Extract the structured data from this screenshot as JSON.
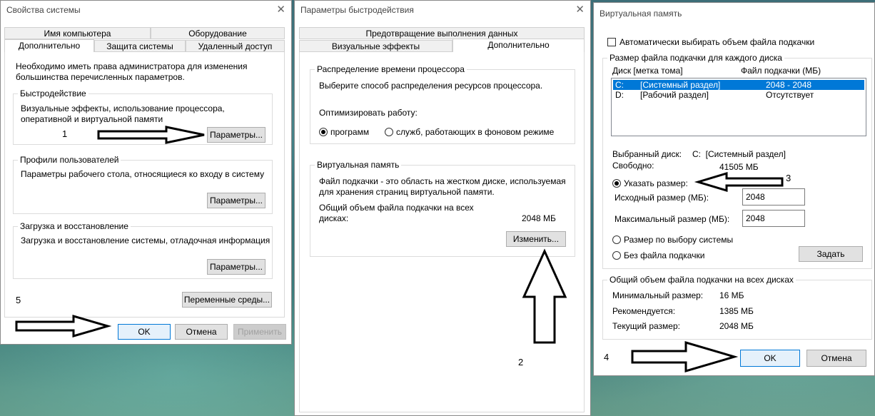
{
  "sys_props": {
    "title": "Свойства системы",
    "tabs_top": [
      "Имя компьютера",
      "Оборудование"
    ],
    "tabs_bottom": [
      "Дополнительно",
      "Защита системы",
      "Удаленный доступ"
    ],
    "admin_note": "Необходимо иметь права администратора для изменения большинства перечисленных параметров.",
    "perf": {
      "title": "Быстродействие",
      "desc": "Визуальные эффекты, использование процессора, оперативной и виртуальной памяти",
      "button": "Параметры..."
    },
    "profiles": {
      "title": "Профили пользователей",
      "desc": "Параметры рабочего стола, относящиеся ко входу в систему",
      "button": "Параметры..."
    },
    "startup": {
      "title": "Загрузка и восстановление",
      "desc": "Загрузка и восстановление системы, отладочная информация",
      "button": "Параметры..."
    },
    "env_button": "Переменные среды...",
    "ok": "OK",
    "cancel": "Отмена",
    "apply": "Применить"
  },
  "perf_opts": {
    "title": "Параметры быстродействия",
    "tab_top": "Предотвращение выполнения данных",
    "tabs_bottom": [
      "Визуальные эффекты",
      "Дополнительно"
    ],
    "cpu": {
      "title": "Распределение времени процессора",
      "desc": "Выберите способ распределения ресурсов процессора.",
      "optimize_label": "Оптимизировать работу:",
      "opt1": "программ",
      "opt2": "служб, работающих в фоновом режиме"
    },
    "vm": {
      "title": "Виртуальная память",
      "desc": "Файл подкачки - это область на жестком диске, используемая для хранения страниц виртуальной памяти.",
      "total_label": "Общий объем файла подкачки на всех дисках:",
      "total_value": "2048 МБ",
      "button": "Изменить..."
    }
  },
  "vmem": {
    "title": "Виртуальная память",
    "auto_label": "Автоматически выбирать объем файла подкачки",
    "group_title": "Размер файла подкачки для каждого диска",
    "col_disk": "Диск [метка тома]",
    "col_file": "Файл подкачки (МБ)",
    "rows": [
      {
        "drive": "C:",
        "label": "[Системный раздел]",
        "size": "2048 - 2048"
      },
      {
        "drive": "D:",
        "label": "[Рабочий раздел]",
        "size": "Отсутствует"
      }
    ],
    "selected_label": "Выбранный диск:",
    "selected_value": "C:  [Системный раздел]",
    "free_label": "Свободно:",
    "free_value": "41505 МБ",
    "custom_label": "Указать размер:",
    "initial_label": "Исходный размер (МБ):",
    "initial_value": "2048",
    "max_label": "Максимальный размер (МБ):",
    "max_value": "2048",
    "system_label": "Размер по выбору системы",
    "none_label": "Без файла подкачки",
    "set_button": "Задать",
    "total_group": "Общий объем файла подкачки на всех дисках",
    "min_label": "Минимальный размер:",
    "min_value": "16 МБ",
    "rec_label": "Рекомендуется:",
    "rec_value": "1385 МБ",
    "cur_label": "Текущий размер:",
    "cur_value": "2048 МБ",
    "ok": "OK",
    "cancel": "Отмена"
  },
  "annotations": {
    "n1": "1",
    "n2": "2",
    "n3": "3",
    "n4": "4",
    "n5": "5"
  }
}
